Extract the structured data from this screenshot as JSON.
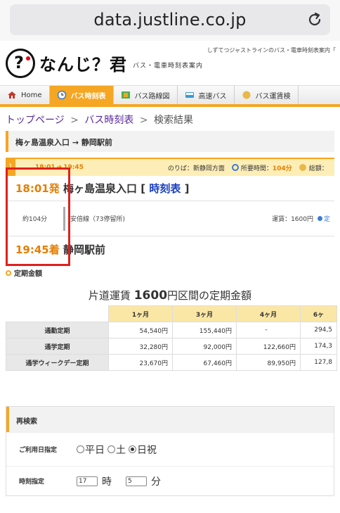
{
  "browser": {
    "url": "data.justline.co.jp"
  },
  "header": {
    "logo_text": "なんじ？君",
    "logo_sub": "バス・電車時刻表案内",
    "tagline": "しずてつジャストラインのバス・電車時刻表案内「"
  },
  "nav": [
    {
      "label": "Home",
      "icon": "house-icon"
    },
    {
      "label": "バス時刻表",
      "icon": "clock-icon",
      "active": true
    },
    {
      "label": "バス路線図",
      "icon": "map-icon"
    },
    {
      "label": "高速バス",
      "icon": "bus-icon"
    },
    {
      "label": "バス運賃検",
      "icon": "coin-icon"
    }
  ],
  "breadcrumb": {
    "top": "トップページ",
    "sep": ">",
    "timetable": "バス時刻表",
    "current": "検索結果"
  },
  "route_heading": "梅ヶ島温泉入口 → 静岡駅前",
  "result": {
    "index": "1",
    "depart": "18:01",
    "arrow": "➔",
    "arrive": "19:45",
    "direction": "のりば：新静岡方面",
    "duration_label": "所要時間：",
    "duration": "104分",
    "total_label": "総額：",
    "origin_time": "18:01発",
    "origin_name": "梅ヶ島温泉入口",
    "timetable_open": "[",
    "timetable_link": "時刻表",
    "timetable_close": "]",
    "segment_duration": "約104分",
    "segment_line": "安倍線（73停留所)",
    "fare": "運賃：1600円",
    "fare_link": "定",
    "dest_time": "19:45着",
    "dest_name": "静岡駅前"
  },
  "pass": {
    "title": "定期金額",
    "caption_pre": "片道運賃",
    "caption_amount": "1600",
    "caption_post": "円区間の定期金額",
    "columns": [
      "1ヶ月",
      "3ヶ月",
      "4ヶ月",
      "6ヶ"
    ],
    "rows": [
      {
        "label": "通勤定期",
        "values": [
          "54,540円",
          "155,440円",
          "-",
          "294,5"
        ]
      },
      {
        "label": "通学定期",
        "values": [
          "32,280円",
          "92,000円",
          "122,660円",
          "174,3"
        ]
      },
      {
        "label": "通学ウィークデー定期",
        "values": [
          "23,670円",
          "67,460円",
          "89,950円",
          "127,8"
        ]
      }
    ]
  },
  "research": {
    "title": "再検索",
    "date_label": "ご利用日指定",
    "options": [
      {
        "label": "平日",
        "selected": false
      },
      {
        "label": "土",
        "selected": false
      },
      {
        "label": "日祝",
        "selected": true
      }
    ],
    "time_label": "時刻指定",
    "hour_value": "17",
    "hour_unit": "時",
    "minute_value": "5",
    "minute_unit": "分"
  },
  "colors": {
    "accent": "#f5a623",
    "time_orange": "#e67e00",
    "highlight_red": "#e0201b",
    "link_blue": "#1a3fbf",
    "breadcrumb_purple": "#5a2a9c"
  }
}
